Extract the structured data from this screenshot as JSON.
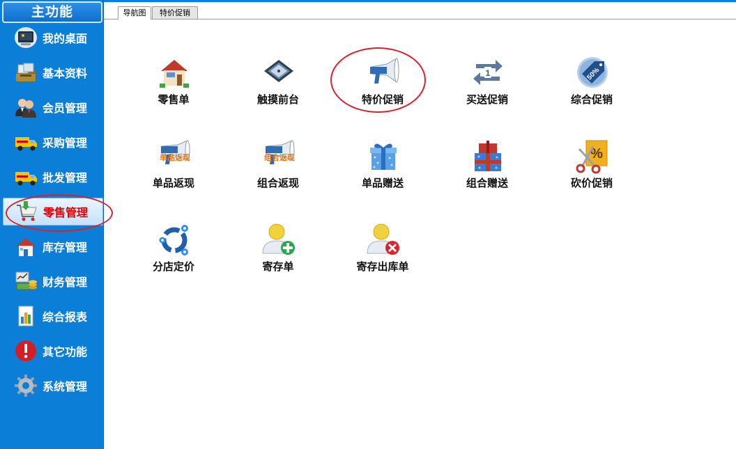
{
  "sidebar": {
    "title": "主功能",
    "items": [
      {
        "label": "我的桌面",
        "icon": "desktop-monitor-icon"
      },
      {
        "label": "基本资料",
        "icon": "briefcase-documents-icon"
      },
      {
        "label": "会员管理",
        "icon": "users-icon"
      },
      {
        "label": "采购管理",
        "icon": "delivery-truck-icon"
      },
      {
        "label": "批发管理",
        "icon": "delivery-truck-icon"
      },
      {
        "label": "零售管理",
        "icon": "shopping-cart-icon",
        "active": true
      },
      {
        "label": "库存管理",
        "icon": "house-icon"
      },
      {
        "label": "财务管理",
        "icon": "money-icon"
      },
      {
        "label": "综合报表",
        "icon": "bar-chart-icon"
      },
      {
        "label": "其它功能",
        "icon": "exclamation-icon"
      },
      {
        "label": "系统管理",
        "icon": "gear-icon"
      }
    ]
  },
  "tabs": [
    {
      "label": "导航图",
      "active": true
    },
    {
      "label": "特价促销",
      "active": false
    }
  ],
  "main": {
    "tiles": [
      {
        "label": "零售单",
        "icon": "store-house-icon"
      },
      {
        "label": "触摸前台",
        "icon": "touch-device-icon"
      },
      {
        "label": "特价促销",
        "icon": "megaphone-icon"
      },
      {
        "label": "买送促销",
        "icon": "repeat-one-icon"
      },
      {
        "label": "综合促销",
        "icon": "discount-tag-icon",
        "tag_text": "50%"
      },
      {
        "label": "单品返现",
        "icon": "megaphone-overlay-icon",
        "overlay_text": "单品返现"
      },
      {
        "label": "组合返现",
        "icon": "megaphone-overlay-icon",
        "overlay_text": "组合返现"
      },
      {
        "label": "单品赠送",
        "icon": "gift-box-icon"
      },
      {
        "label": "组合赠送",
        "icon": "gift-stack-icon"
      },
      {
        "label": "砍价促销",
        "icon": "scissors-percent-icon",
        "tag_text": "%"
      },
      {
        "label": "分店定价",
        "icon": "branch-gears-icon"
      },
      {
        "label": "寄存单",
        "icon": "user-add-icon"
      },
      {
        "label": "寄存出库单",
        "icon": "user-remove-icon"
      }
    ]
  },
  "colors": {
    "sidebar_bg": "#0b7ed8",
    "highlight_circle": "#d9212b",
    "active_label": "#e00000"
  }
}
